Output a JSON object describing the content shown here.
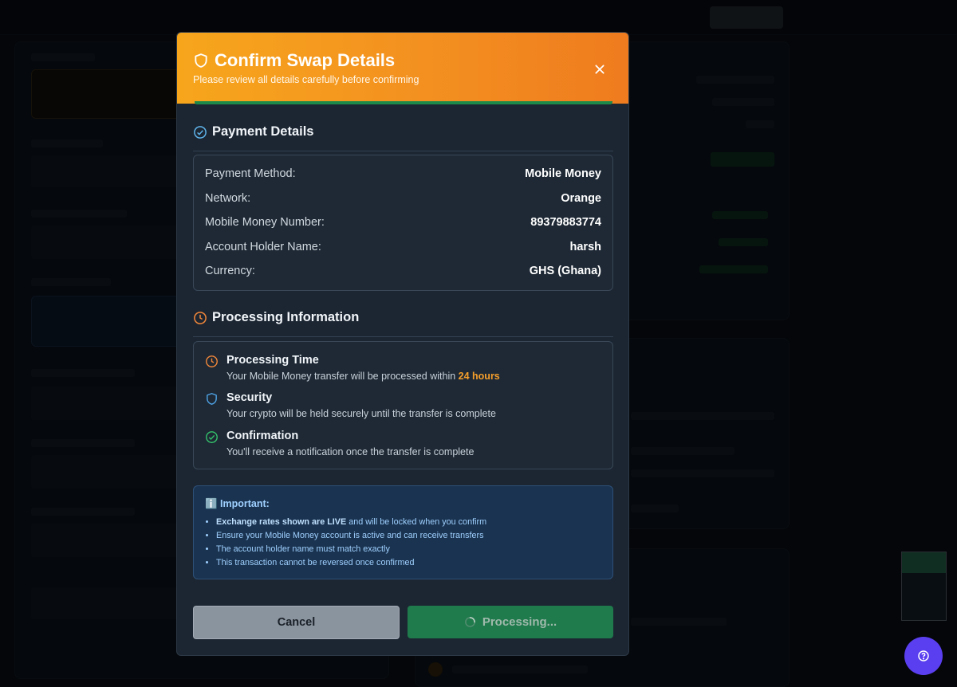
{
  "modal": {
    "title": "Confirm Swap Details",
    "subtitle": "Please review all details carefully before confirming",
    "payment_section_title": "Payment Details",
    "payment_rows": [
      {
        "label": "Payment Method:",
        "value": "Mobile Money"
      },
      {
        "label": "Network:",
        "value": "Orange"
      },
      {
        "label": "Mobile Money Number:",
        "value": "89379883774"
      },
      {
        "label": "Account Holder Name:",
        "value": "harsh"
      },
      {
        "label": "Currency:",
        "value": "GHS (Ghana)"
      }
    ],
    "processing_section_title": "Processing Information",
    "processing_items": [
      {
        "title": "Processing Time",
        "desc_prefix": "Your Mobile Money transfer will be processed within ",
        "highlight": "24 hours"
      },
      {
        "title": "Security",
        "desc": "Your crypto will be held securely until the transfer is complete"
      },
      {
        "title": "Confirmation",
        "desc": "You'll receive a notification once the transfer is complete"
      }
    ],
    "important": {
      "heading": "ℹ️ Important:",
      "items": [
        {
          "bold": "Exchange rates shown are LIVE",
          "rest": " and will be locked when you confirm"
        },
        {
          "rest": "Ensure your Mobile Money account is active and can receive transfers"
        },
        {
          "rest": "The account holder name must match exactly"
        },
        {
          "rest": "This transaction cannot be reversed once confirmed"
        }
      ]
    },
    "cancel_label": "Cancel",
    "processing_label": "Processing..."
  },
  "colors": {
    "header_gradient_start": "#f7a61c",
    "header_gradient_end": "#ef7b1e",
    "accent_orange": "#f59e2b",
    "success_green": "#1f7a4c",
    "info_blue": "#9fd0ff",
    "fab_purple": "#5a3ff0"
  },
  "icons": {
    "title": "shield-icon",
    "close": "close-icon",
    "payment": "check-circle-icon",
    "processing": "clock-icon",
    "processing_time": "clock-icon",
    "security": "shield-icon",
    "confirmation": "check-circle-icon",
    "spinner": "spinner-icon",
    "help": "help-circle-icon"
  }
}
